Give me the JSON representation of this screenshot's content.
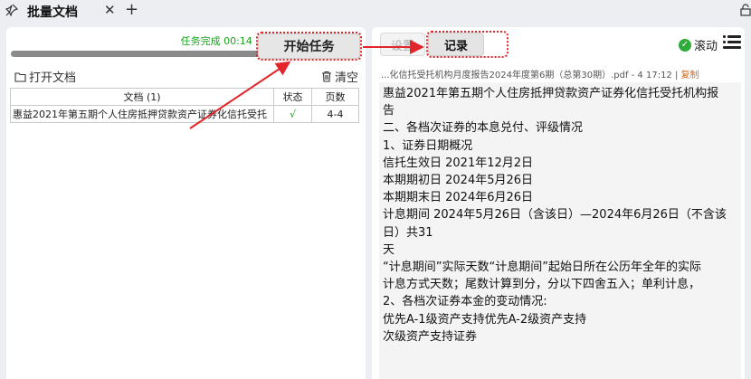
{
  "titlebar": {
    "pin_icon": "pin-icon",
    "tab_title": "批量文档",
    "close_symbol": "✕",
    "add_symbol": "+",
    "lock_icon": "lock-icon"
  },
  "left": {
    "task_status": "任务完成  00:14  1/1",
    "progress": 1.0,
    "start_button": "开始任务",
    "open_doc": "打开文档",
    "clear": "清空",
    "table": {
      "headers": [
        "文档 (1)",
        "状态",
        "页数"
      ],
      "rows": [
        {
          "doc": "惠益2021年第五期个人住房抵押贷款资产证券化信托受托",
          "status": "√",
          "pages": "4-4"
        }
      ]
    }
  },
  "right": {
    "tabs": {
      "settings": "设置",
      "log": "记录"
    },
    "scroll_label": "滚动",
    "log_header": "...化信托受托机构月度报告2024年度第6期（总第30期）.pdf - 4  17:12 | ",
    "copy_label": "复制",
    "log_lines": [
      "惠益2021年第五期个人住房抵押贷款资产证券化信托受托机构报",
      "告",
      "二、各档次证券的本息兑付、评级情况",
      "1、证券日期概况",
      "信托生效日 2021年12月2日",
      "本期期初日 2024年5月26日",
      "本期期末日 2024年6月26日",
      "计息期间 2024年5月26日（含该日）—2024年6月26日（不含该日）共31",
      "天",
      "“计息期间”实际天数“计息期间”起始日所在公历年全年的实际",
      "计息方式天数；尾数计算到分，分以下四舍五入；单利计息，",
      "2、各档次证券本金的变动情况:",
      "优先A-1级资产支持优先A-2级资产支持",
      "次级资产支持证券"
    ]
  },
  "colors": {
    "accent_red": "#e2252b",
    "success_green": "#1aa31a"
  }
}
